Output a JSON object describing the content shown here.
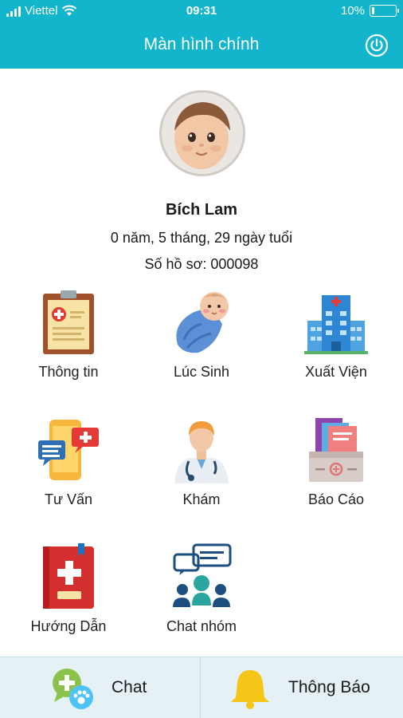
{
  "status_bar": {
    "carrier": "Viettel",
    "time": "09:31",
    "battery_percent": "10%",
    "battery_level": 0.1
  },
  "app_bar": {
    "title": "Màn hình chính",
    "power_icon": "power-icon"
  },
  "profile": {
    "avatar_icon": "baby-avatar",
    "name": "Bích Lam",
    "age": "0 năm, 5 tháng, 29 ngày tuổi",
    "record": "Số hồ sơ: 000098"
  },
  "menu": [
    {
      "label": "Thông tin",
      "icon": "clipboard-medical-icon"
    },
    {
      "label": "Lúc Sinh",
      "icon": "swaddled-baby-icon"
    },
    {
      "label": "Xuất Viện",
      "icon": "hospital-building-icon"
    },
    {
      "label": "Tư Vấn",
      "icon": "chat-phone-icon"
    },
    {
      "label": "Khám",
      "icon": "doctor-icon"
    },
    {
      "label": "Báo Cáo",
      "icon": "report-box-icon"
    },
    {
      "label": "Hướng Dẫn",
      "icon": "medical-book-icon"
    },
    {
      "label": "Chat nhóm",
      "icon": "group-chat-icon"
    }
  ],
  "bottom_bar": {
    "chat_label": "Chat",
    "notify_label": "Thông Báo"
  },
  "colors": {
    "primary": "#12b5cb",
    "bottom_bar": "#e6f1f6",
    "bell": "#f5c518"
  }
}
